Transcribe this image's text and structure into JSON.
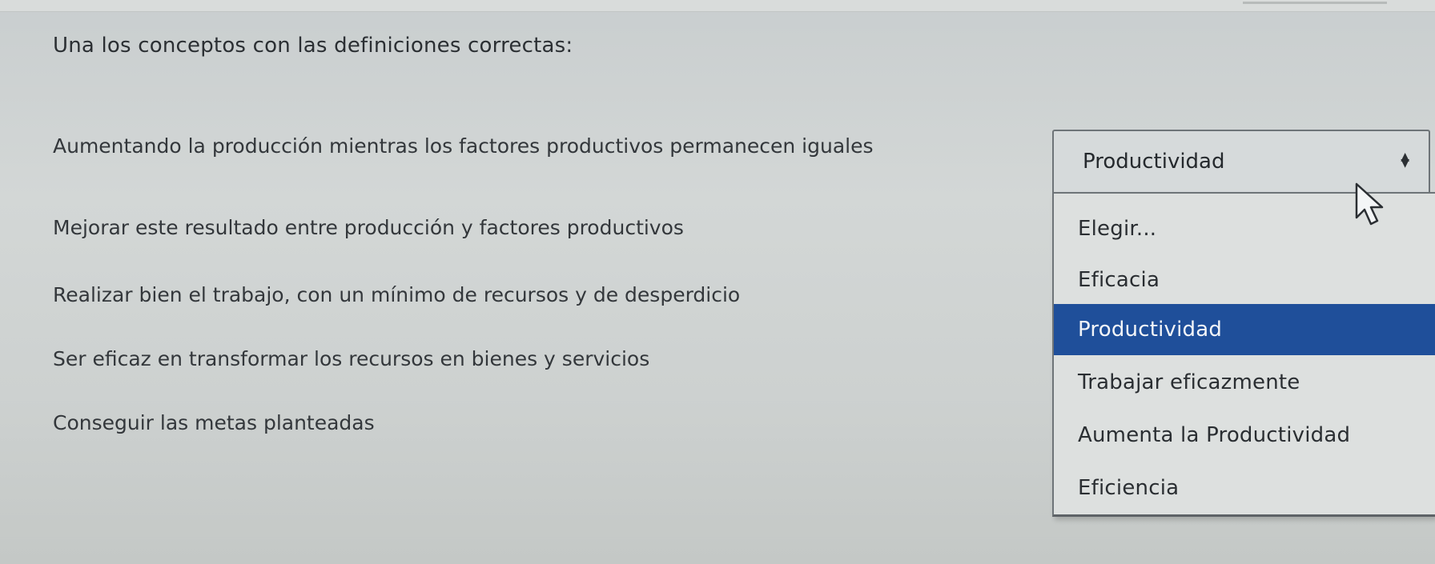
{
  "question": {
    "title": "Una los conceptos con las definiciones correctas:"
  },
  "rows": [
    {
      "label": "Aumentando la producción mientras los factores productivos permanecen iguales"
    },
    {
      "label": "Mejorar este resultado entre producción y factores productivos"
    },
    {
      "label": "Realizar bien el trabajo, con un mínimo de recursos y de desperdicio"
    },
    {
      "label": "Ser eficaz en transformar los recursos en bienes y servicios"
    },
    {
      "label": "Conseguir las metas planteadas"
    }
  ],
  "select": {
    "value": "Productividad",
    "arrow_icon": "up-down-arrows-icon",
    "options": [
      {
        "label": "Elegir..."
      },
      {
        "label": "Eficacia"
      },
      {
        "label": "Productividad"
      },
      {
        "label": "Trabajar eficazmente"
      },
      {
        "label": "Aumenta la Productividad"
      },
      {
        "label": "Eficiencia"
      }
    ],
    "highlight_color": "#1f4f9a"
  }
}
